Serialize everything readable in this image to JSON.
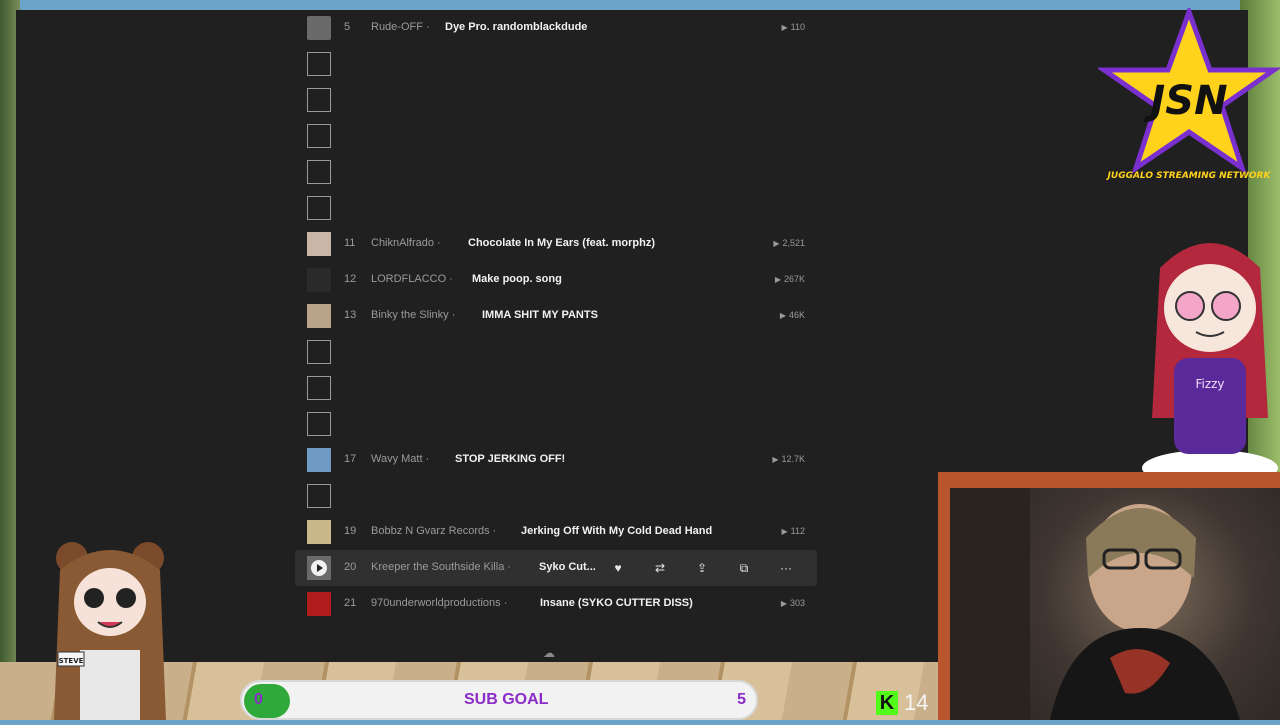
{
  "tracks": [
    {
      "num": "5",
      "artist": "Rude-OFF",
      "title": "Dye Pro. randomblackdude",
      "plays": "110"
    },
    {
      "num": "11",
      "artist": "ChiknAlfrado",
      "title": "Chocolate In My Ears (feat. morphz)",
      "plays": "2,521"
    },
    {
      "num": "12",
      "artist": "LORDFLACCO",
      "title": "Make poop. song",
      "plays": "267K"
    },
    {
      "num": "13",
      "artist": "Binky the Slinky",
      "title": "IMMA SHIT MY PANTS",
      "plays": "46K"
    },
    {
      "num": "17",
      "artist": "Wavy Matt",
      "title": "STOP JERKING OFF!",
      "plays": "12.7K"
    },
    {
      "num": "19",
      "artist": "Bobbz N Gvarz Records",
      "title": "Jerking Off With My Cold Dead Hand",
      "plays": "112"
    },
    {
      "num": "20",
      "artist": "Kreeper the Southside Killa",
      "title": "Syko Cut..."
    },
    {
      "num": "21",
      "artist": "970underworldproductions",
      "title": "Insane (SYKO CUTTER DISS)",
      "plays": "303"
    }
  ],
  "separator": "·",
  "overlay": {
    "sub_goal": {
      "label": "SUB GOAL",
      "current": "0",
      "target": "5",
      "progress_fraction": 0.09
    },
    "kick_count": "14",
    "jsn_logo_text": "JSN",
    "jsn_subtitle": "JUGGALO STREAMING NETWORK",
    "fizzy_shirt": "Fizzy",
    "steve_badge": "STEVE"
  },
  "colors": {
    "kick": "#53fc18",
    "sub_goal_text": "#8b2cc9",
    "sub_goal_fill": "#2faa3a"
  },
  "icons": [
    "play-icon",
    "heart-icon",
    "repost-icon",
    "share-icon",
    "copy-link-icon",
    "more-icon",
    "soundcloud-logo-icon"
  ]
}
